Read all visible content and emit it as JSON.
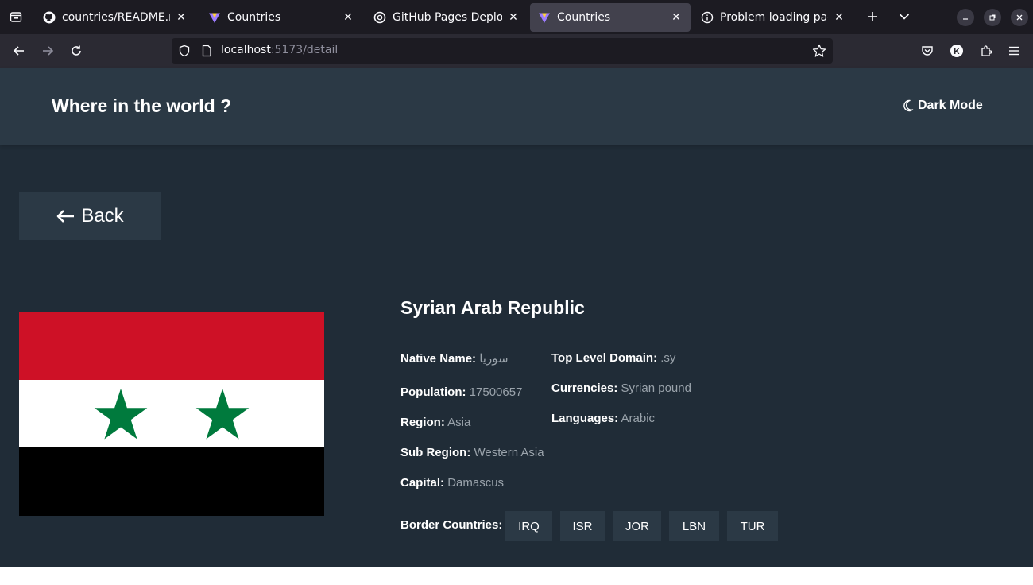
{
  "browser": {
    "tabs": [
      {
        "title": "countries/README.md",
        "icon": "github-icon",
        "active": false
      },
      {
        "title": "Countries",
        "icon": "vite-icon",
        "active": false
      },
      {
        "title": "GitHub Pages Deployment",
        "icon": "openai-icon",
        "active": false
      },
      {
        "title": "Countries",
        "icon": "vite-icon",
        "active": true
      },
      {
        "title": "Problem loading page",
        "icon": "info-icon",
        "active": false
      }
    ],
    "url_host": "localhost",
    "url_rest": ":5173/detail"
  },
  "app": {
    "title": "Where in the world ?",
    "dark_mode_label": "Dark Mode",
    "back_label": "Back"
  },
  "country": {
    "name": "Syrian Arab Republic",
    "native_name_label": "Native Name:",
    "native_name": "سوريا",
    "population_label": "Population:",
    "population": "17500657",
    "region_label": "Region:",
    "region": "Asia",
    "subregion_label": "Sub Region:",
    "subregion": "Western Asia",
    "capital_label": "Capital:",
    "capital": "Damascus",
    "tld_label": "Top Level Domain:",
    "tld": ".sy",
    "currencies_label": "Currencies:",
    "currencies": "Syrian pound",
    "languages_label": "Languages:",
    "languages": "Arabic",
    "border_label": "Border Countries:",
    "borders": [
      "IRQ",
      "ISR",
      "JOR",
      "LBN",
      "TUR"
    ]
  },
  "colors": {
    "background": "#202c37",
    "element": "#2b3945",
    "flag_red": "#ce1126",
    "flag_white": "#ffffff",
    "flag_black": "#000000",
    "flag_green": "#007a3d"
  }
}
